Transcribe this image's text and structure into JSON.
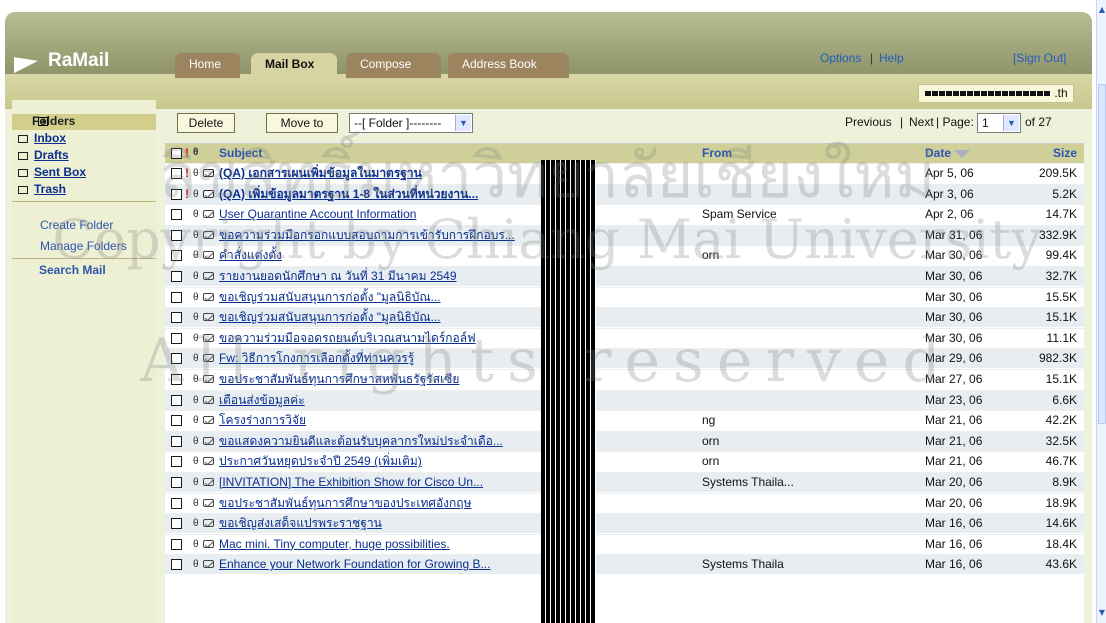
{
  "app": {
    "logo_text": "RaMail",
    "tabs": [
      "Home",
      "Mail Box",
      "Compose",
      "Address Book"
    ],
    "active_tab": "Mail Box",
    "top_links": {
      "options": "Options",
      "help": "Help",
      "separator": "|",
      "sign_out": "[Sign Out]"
    },
    "email_suffix": ".th"
  },
  "sidebar": {
    "title": "Folders",
    "folders": [
      "Inbox",
      "Drafts",
      "Sent Box",
      "Trash"
    ],
    "links": [
      "Create Folder",
      "Manage Folders"
    ],
    "search_label": "Search Mail"
  },
  "controls": {
    "delete": "Delete",
    "move_to": "Move to",
    "folder_select": "--[ Folder ]--------",
    "previous": "Previous",
    "pipe": "|",
    "next": "Next",
    "page_label": "| Page:",
    "page_value": "1",
    "total_pages": "of 27"
  },
  "table": {
    "headers": {
      "subject": "Subject",
      "from": "From",
      "date": "Date",
      "size": "Size"
    },
    "rows": [
      {
        "subject": "(QA) เอกสารเผนเพิ่มข้อมูลในมาตรฐาน",
        "from": "",
        "date": "Apr 5, 06",
        "size": "209.5K",
        "unread": true,
        "important": true
      },
      {
        "subject": "(QA) เพิ่มข้อมูลมาตรฐาน 1-8 ในส่วนที่หน่วยงาน...",
        "from": "",
        "date": "Apr 3, 06",
        "size": "5.2K",
        "unread": true,
        "important": true
      },
      {
        "subject": "User Quarantine Account Information",
        "from": "Spam Service",
        "date": "Apr 2, 06",
        "size": "14.7K"
      },
      {
        "subject": "ขอความร่วมมือกรอกแบบสอบถามการเข้ารับการฝึกอบร...",
        "from": "",
        "date": "Mar 31, 06",
        "size": "332.9K"
      },
      {
        "subject": "คำสั่งแต่งตั้ง",
        "from": "orn",
        "date": "Mar 30, 06",
        "size": "99.4K"
      },
      {
        "subject": "รายงานยอดนักศึกษา ณ วันที่ 31 มีนาคม 2549",
        "from": "",
        "date": "Mar 30, 06",
        "size": "32.7K"
      },
      {
        "subject": "ขอเชิญร่วมสนับสนุนการก่อตั้ง \"มูลนิธิบัณ...",
        "from": "",
        "date": "Mar 30, 06",
        "size": "15.5K"
      },
      {
        "subject": "ขอเชิญร่วมสนับสนุนการก่อตั้ง \"มูลนิธิบัณ...",
        "from": "",
        "date": "Mar 30, 06",
        "size": "15.1K"
      },
      {
        "subject": "ขอความร่วมมือจอดรถยนต์บริเวณสนามไดร์กอล์ฟ",
        "from": "",
        "date": "Mar 30, 06",
        "size": "11.1K"
      },
      {
        "subject": "Fw: วิธีการโกงการเลือกตั้งที่ท่านควรรู้",
        "from": "",
        "date": "Mar 29, 06",
        "size": "982.3K"
      },
      {
        "subject": "ขอประชาสัมพันธ์ทุนการศึกษาสหพันธรัฐรัสเซีย",
        "from": "",
        "date": "Mar 27, 06",
        "size": "15.1K"
      },
      {
        "subject": "เตือนส่งข้อมูลค่ะ",
        "from": "",
        "date": "Mar 23, 06",
        "size": "6.6K"
      },
      {
        "subject": "โครงร่างการวิจัย",
        "from": "ng",
        "date": "Mar 21, 06",
        "size": "42.2K"
      },
      {
        "subject": "ขอแสดงความยินดีและต้อนรับบุคลากรใหม่ประจำเดือ...",
        "from": "orn",
        "date": "Mar 21, 06",
        "size": "32.5K"
      },
      {
        "subject": "ประกาศวันหยุดประจำปี 2549 (เพิ่มเติม)",
        "from": "orn",
        "date": "Mar 21, 06",
        "size": "46.7K"
      },
      {
        "subject": "[INVITATION] The Exhibition Show for Cisco Un...",
        "from": "Systems Thaila...",
        "date": "Mar 20, 06",
        "size": "8.9K"
      },
      {
        "subject": "ขอประชาสัมพันธ์ทุนการศึกษาของประเทศอังกฤษ",
        "from": "",
        "date": "Mar 20, 06",
        "size": "18.9K"
      },
      {
        "subject": "ขอเชิญส่งเสด็จแปรพระราชฐาน",
        "from": "",
        "date": "Mar 16, 06",
        "size": "14.6K"
      },
      {
        "subject": "Mac mini. Tiny computer, huge possibilities.",
        "from": "",
        "date": "Mar 16, 06",
        "size": "18.4K"
      },
      {
        "subject": "Enhance your Network Foundation for Growing B...",
        "from": "Systems Thaila",
        "date": "Mar 16, 06",
        "size": "43.6K"
      }
    ]
  },
  "watermark": {
    "line1": "ลิขสิทธิ์มหาวิทยาลัยเชียงใหม่",
    "line2": "Copyright by Chiang Mai University",
    "line3": "All rights reserved"
  }
}
